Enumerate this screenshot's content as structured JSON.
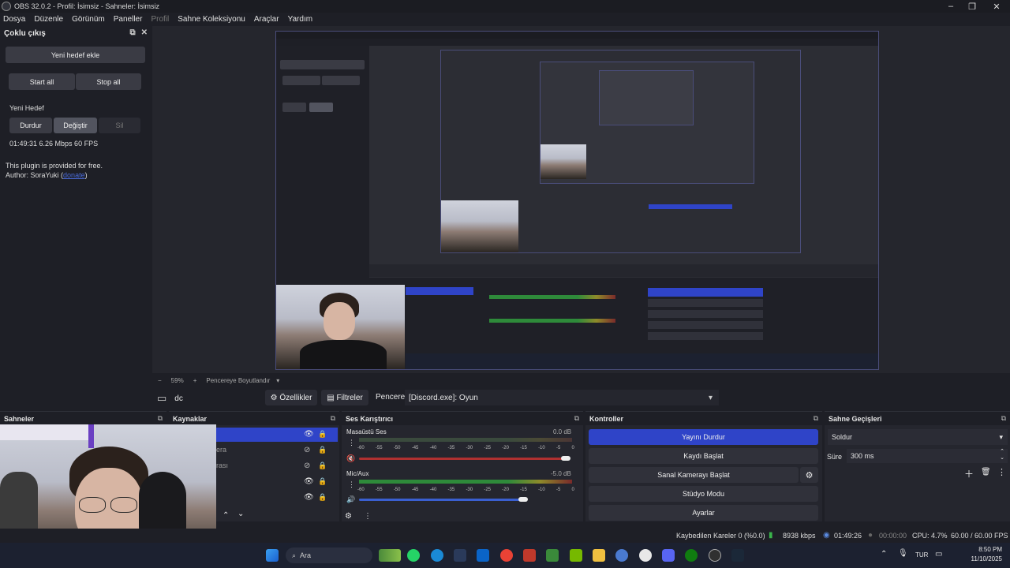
{
  "window": {
    "title": "OBS 32.0.2 - Profil: İsimsiz - Sahneler: İsimsiz",
    "minimize": "–",
    "restore": "❐",
    "close": "✕"
  },
  "menu": {
    "items": [
      "Dosya",
      "Düzenle",
      "Görünüm",
      "Paneller",
      "Profil",
      "Sahne Koleksiyonu",
      "Araçlar",
      "Yardım"
    ]
  },
  "multi_output": {
    "title": "Çoklu çıkış",
    "add_target": "Yeni hedef ekle",
    "start_all": "Start all",
    "stop_all": "Stop all",
    "target_name": "Yeni Hedef",
    "stop": "Durdur",
    "change": "Değiştir",
    "delete": "Sil",
    "stats": "01:49:31  6.26 Mbps  60 FPS",
    "free_note": "This plugin is provided for free.",
    "author_prefix": "Author: SoraYuki (",
    "donate": "donate",
    "author_suffix": ")"
  },
  "zoom": {
    "minus": "−",
    "value": "59%",
    "plus": "+",
    "fit": "Pencereye Boyutlandır"
  },
  "context": {
    "source_name": "dc",
    "properties": "Özellikler",
    "filters": "Filtreler",
    "window_label": "Pencere",
    "window_value": "[Discord.exe]: Oyun"
  },
  "scenes": {
    "title": "Sahneler"
  },
  "sources": {
    "title": "Kaynaklar",
    "items": [
      "",
      "era",
      "rası",
      "",
      ""
    ]
  },
  "mixer": {
    "title": "Ses Karıştırıcı",
    "channels": [
      {
        "name": "Masaüstü Ses",
        "db": "0.0 dB"
      },
      {
        "name": "Mic/Aux",
        "db": "-5.0 dB"
      }
    ],
    "ticks": [
      "-60",
      "-55",
      "-50",
      "-45",
      "-40",
      "-35",
      "-30",
      "-25",
      "-20",
      "-15",
      "-10",
      "-5",
      "0"
    ]
  },
  "controls": {
    "title": "Kontroller",
    "stop_stream": "Yayını Durdur",
    "start_record": "Kaydı Başlat",
    "virtual_cam": "Sanal Kamerayı Başlat",
    "studio_mode": "Stüdyo Modu",
    "settings": "Ayarlar"
  },
  "transitions": {
    "title": "Sahne Geçişleri",
    "type": "Soldur",
    "duration_label": "Süre",
    "duration_value": "300 ms"
  },
  "status": {
    "dropped": "Kaybedilen Kareler 0 (%0.0)",
    "bitrate": "8938 kbps",
    "stream_time": "01:49:26",
    "record_time": "00:00:00",
    "cpu": "CPU: 4.7%",
    "fps": "60.00 / 60.00 FPS"
  },
  "taskbar": {
    "search": "Ara",
    "lang": "TUR",
    "time": "8:50 PM",
    "date": "11/10/2025"
  },
  "colors": {
    "accent": "#2f44c8",
    "bg": "#1e1f26",
    "panel": "#25262e"
  }
}
